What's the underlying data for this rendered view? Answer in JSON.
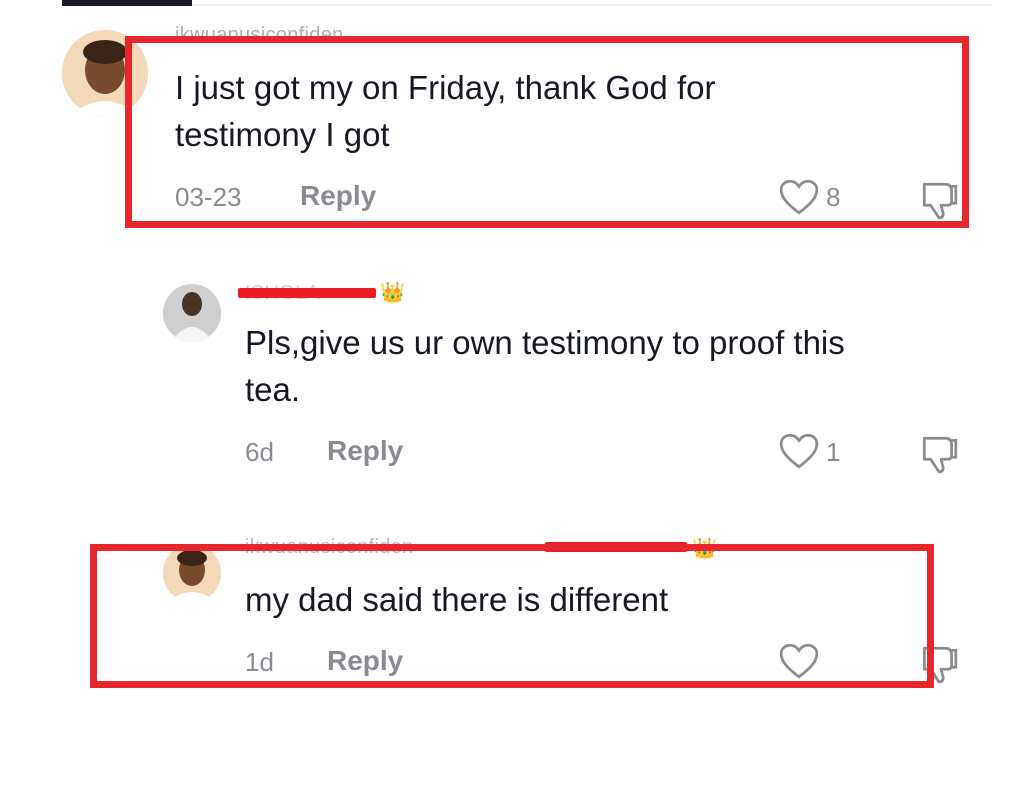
{
  "comments": [
    {
      "username": "ikwuanusiconfiden",
      "text_line1": "I just got my on Friday, thank God for",
      "text_line2": "testimony I got",
      "date": "03-23",
      "reply_label": "Reply",
      "like_count": "8"
    },
    {
      "username": "ISHOLA",
      "crown": "👑",
      "text_line1": "Pls,give us ur own testimony to proof this",
      "text_line2": "tea.",
      "date": "6d",
      "reply_label": "Reply",
      "like_count": "1"
    },
    {
      "username": "ikwuanusiconfiden",
      "reply_to": "ISHOLA",
      "crown": "👑",
      "text_line1": "my dad said there is different",
      "date": "1d",
      "reply_label": "Reply",
      "like_count": ""
    }
  ],
  "colors": {
    "highlight": "#e8262d",
    "redaction": "#ea1c24",
    "secondary_text": "#8a8b91",
    "primary_text": "#161823"
  },
  "icons": [
    "heart-outline-icon",
    "dislike-thumb-icon"
  ]
}
